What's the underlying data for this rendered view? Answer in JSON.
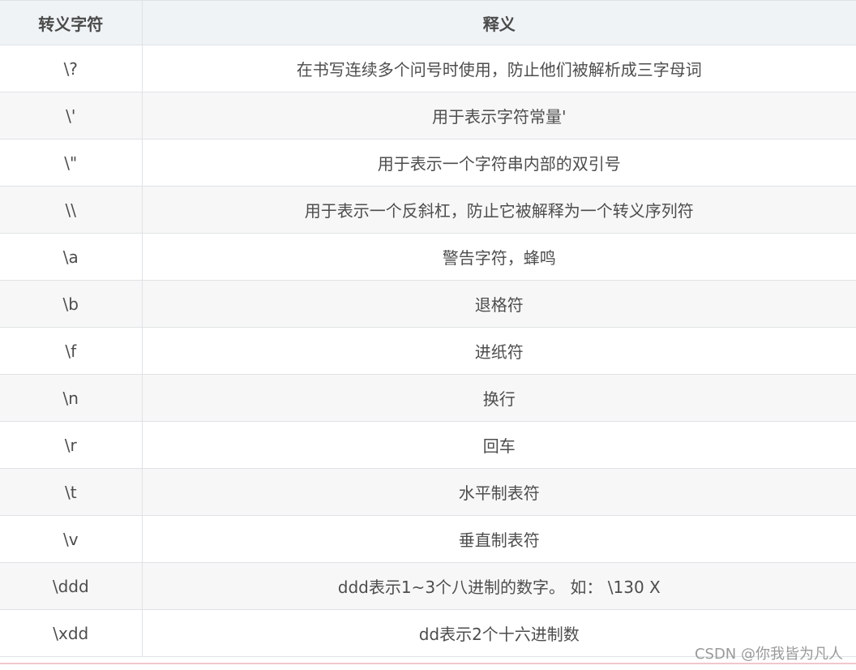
{
  "table": {
    "headers": [
      "转义字符",
      "释义"
    ],
    "rows": [
      [
        "\\?",
        "在书写连续多个问号时使用，防止他们被解析成三字母词"
      ],
      [
        "\\'",
        "用于表示字符常量'"
      ],
      [
        "\\\"",
        "用于表示一个字符串内部的双引号"
      ],
      [
        "\\\\",
        "用于表示一个反斜杠，防止它被解释为一个转义序列符"
      ],
      [
        "\\a",
        "警告字符，蜂鸣"
      ],
      [
        "\\b",
        "退格符"
      ],
      [
        "\\f",
        "进纸符"
      ],
      [
        "\\n",
        "换行"
      ],
      [
        "\\r",
        "回车"
      ],
      [
        "\\t",
        "水平制表符"
      ],
      [
        "\\v",
        "垂直制表符"
      ],
      [
        "\\ddd",
        "ddd表示1~3个八进制的数字。 如： \\130 X"
      ],
      [
        "\\xdd",
        "dd表示2个十六进制数"
      ]
    ]
  },
  "watermark": "CSDN @你我皆为凡人"
}
